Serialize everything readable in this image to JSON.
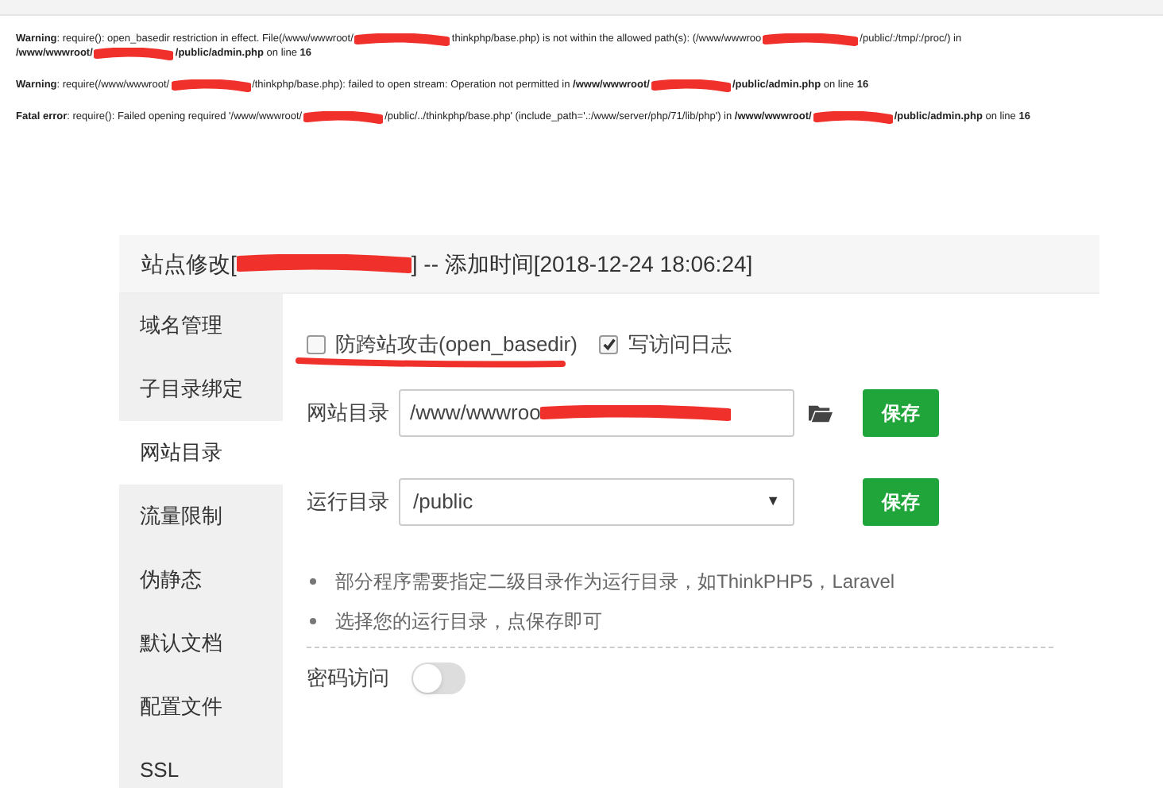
{
  "errors": [
    {
      "segments": [
        "**Warning**: require(): open_basedir restriction in effect. File(/www/wwwroot/",
        "thinkphp/base.php) is not within the allowed path(s): (/www/wwwroo",
        "/public/:/tmp/:/proc/) in"
      ],
      "line2": [
        "**/www/wwwroot/**",
        "**/public/admin.php** on line **16**"
      ]
    },
    {
      "segments": [
        "**Warning**: require(/www/wwwroot/",
        "/thinkphp/base.php): failed to open stream: Operation not permitted in **/www/wwwroot/**",
        "**/public/admin.php** on line **16**"
      ]
    },
    {
      "segments": [
        "**Fatal error**: require(): Failed opening required '/www/wwwroot/",
        "/public/../thinkphp/base.php' (include_path='.:/www/server/php/71/lib/php') in **/www/wwwroot/**",
        "**/public/admin.php** on line **16**"
      ]
    }
  ],
  "dialog": {
    "title_segments": [
      "站点修改[",
      "] -- 添加时间[2018-12-24 18:06:24]"
    ],
    "sidebar": [
      {
        "label": "域名管理",
        "selected": false
      },
      {
        "label": "子目录绑定",
        "selected": false
      },
      {
        "label": "网站目录",
        "selected": true
      },
      {
        "label": "流量限制",
        "selected": false
      },
      {
        "label": "伪静态",
        "selected": false
      },
      {
        "label": "默认文档",
        "selected": false
      },
      {
        "label": "配置文件",
        "selected": false
      },
      {
        "label": "SSL",
        "selected": false
      }
    ],
    "checkboxes": [
      {
        "label": "防跨站攻击(open_basedir)",
        "checked": false
      },
      {
        "label": "写访问日志",
        "checked": true
      }
    ],
    "site_dir": {
      "label": "网站目录",
      "value": "/www/wwwroo",
      "button": "保存"
    },
    "run_dir": {
      "label": "运行目录",
      "value": "/public",
      "caret": "▼",
      "button": "保存"
    },
    "notes": [
      "部分程序需要指定二级目录作为运行目录，如ThinkPHP5，Laravel",
      "选择您的运行目录，点保存即可"
    ],
    "password_access": {
      "label": "密码访问",
      "on": false
    }
  }
}
